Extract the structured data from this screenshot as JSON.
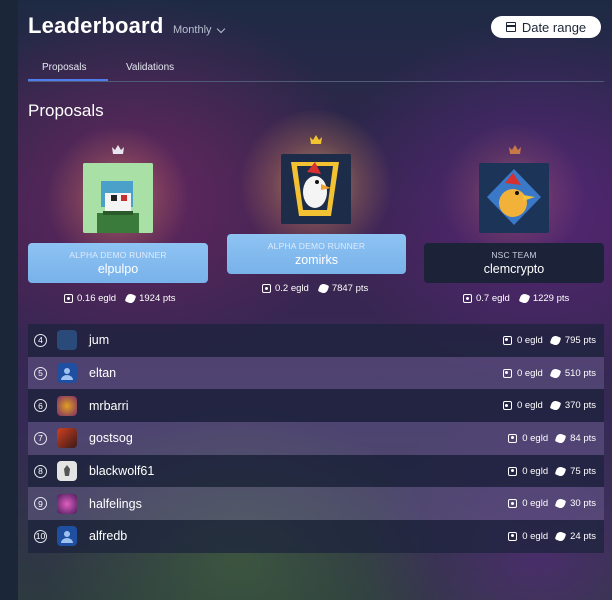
{
  "header": {
    "title": "Leaderboard",
    "period": "Monthly",
    "date_range_label": "Date range"
  },
  "tabs": [
    {
      "label": "Proposals",
      "active": true
    },
    {
      "label": "Validations",
      "active": false
    }
  ],
  "section_title": "Proposals",
  "podium": [
    {
      "place": 2,
      "team": "ALPHA DEMO RUNNER",
      "username": "elpulpo",
      "egld": "0.16 egld",
      "pts": "1924 pts",
      "crown_color": "#e8e4f0"
    },
    {
      "place": 1,
      "team": "ALPHA DEMO RUNNER",
      "username": "zomirks",
      "egld": "0.2 egld",
      "pts": "7847 pts",
      "crown_color": "#f2c232"
    },
    {
      "place": 3,
      "team": "NSC TEAM",
      "username": "clemcrypto",
      "egld": "0.7 egld",
      "pts": "1229 pts",
      "crown_color": "#c8794a"
    }
  ],
  "rows": [
    {
      "rank": "4",
      "name": "jum",
      "egld": "0 egld",
      "pts": "795 pts",
      "avatar_color": "#2a4a7a"
    },
    {
      "rank": "5",
      "name": "eltan",
      "egld": "0 egld",
      "pts": "510 pts",
      "avatar_color": "#1e4fa0"
    },
    {
      "rank": "6",
      "name": "mrbarri",
      "egld": "0 egld",
      "pts": "370 pts",
      "avatar_color": "#7a2a6a"
    },
    {
      "rank": "7",
      "name": "gostsog",
      "egld": "0 egld",
      "pts": "84 pts",
      "avatar_color": "#8a3a2a"
    },
    {
      "rank": "8",
      "name": "blackwolf61",
      "egld": "0 egld",
      "pts": "75 pts",
      "avatar_color": "#d8d8d8"
    },
    {
      "rank": "9",
      "name": "halfelings",
      "egld": "0 egld",
      "pts": "30 pts",
      "avatar_color": "#6a2a7a"
    },
    {
      "rank": "10",
      "name": "alfredb",
      "egld": "0 egld",
      "pts": "24 pts",
      "avatar_color": "#1e4fa0"
    }
  ]
}
